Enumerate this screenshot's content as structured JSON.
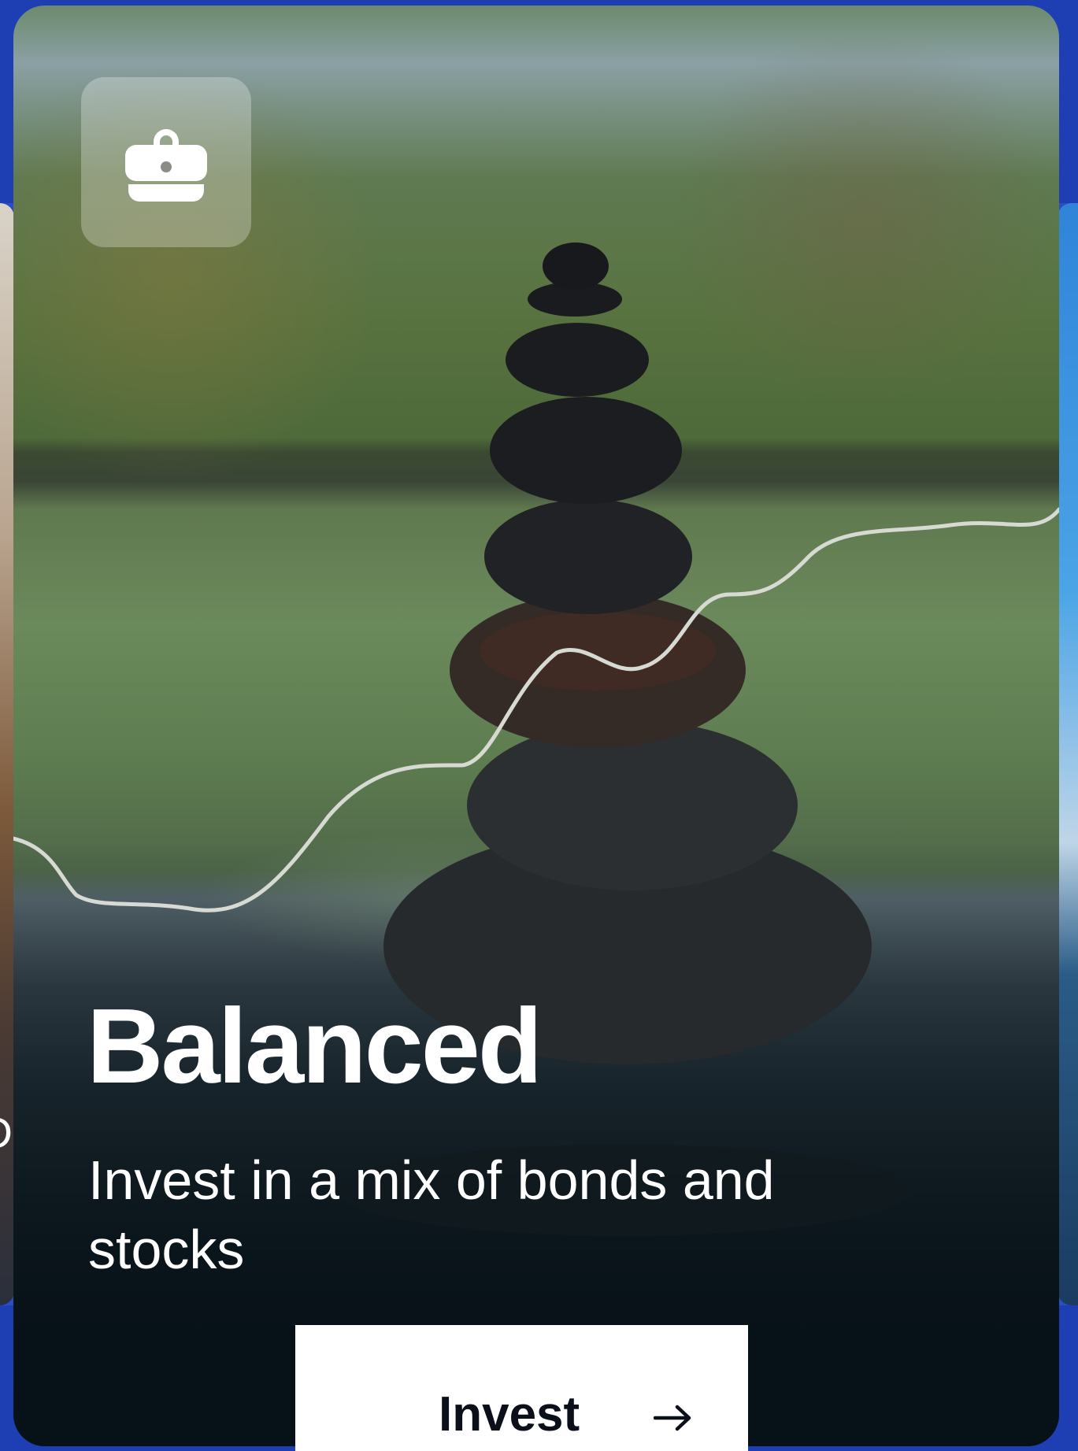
{
  "card": {
    "title": "Balanced",
    "subtitle": "Invest in a mix of bonds and stocks",
    "icon": "briefcase-icon",
    "cta_label": "Invest",
    "cta_icon": "arrow-right-icon"
  },
  "neighbors": {
    "left_fragment": "D"
  },
  "colors": {
    "page_background": "#1e3fb4",
    "button_background": "#ffffff",
    "text": "#ffffff"
  }
}
